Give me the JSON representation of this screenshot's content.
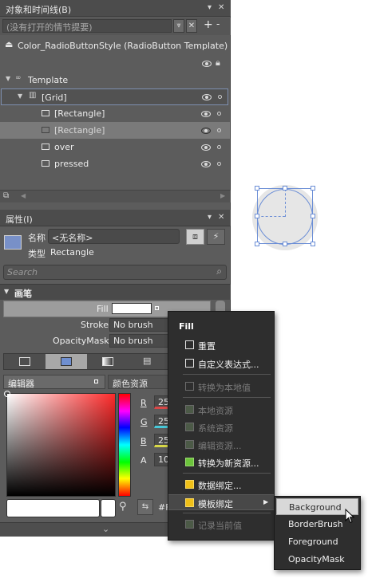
{
  "objects_panel": {
    "title": "对象和时间线(B)",
    "storyboard_placeholder": "(没有打开的情节提要)",
    "scope_title": "Color_RadioButtonStyle (RadioButton Template)",
    "tree": [
      {
        "label": "Template"
      },
      {
        "label": "[Grid]"
      },
      {
        "label": "[Rectangle]"
      },
      {
        "label": "[Rectangle]"
      },
      {
        "label": "over"
      },
      {
        "label": "pressed"
      }
    ]
  },
  "properties_panel": {
    "title": "属性(I)",
    "name_label": "名称",
    "name_value": "<无名称>",
    "type_label": "类型",
    "type_value": "Rectangle",
    "search_placeholder": "Search",
    "section_brush": "画笔",
    "fill_label": "Fill",
    "stroke_label": "Stroke",
    "stroke_value": "No brush",
    "opacitymask_label": "OpacityMask",
    "opacitymask_value": "No brush",
    "tab_editor": "编辑器",
    "tab_color_resources": "颜色资源",
    "channel_r": "R",
    "channel_g": "G",
    "channel_b": "B",
    "channel_a": "A",
    "value_r": "25",
    "value_g": "25",
    "value_b": "25",
    "value_a": "10",
    "hex_value": "#F"
  },
  "context_menu": {
    "header": "Fill",
    "items": [
      {
        "label": "重置",
        "enabled": true
      },
      {
        "label": "自定义表达式...",
        "enabled": true
      },
      {
        "label": "转换为本地值",
        "enabled": false
      },
      {
        "label": "本地资源",
        "enabled": false
      },
      {
        "label": "系统资源",
        "enabled": false
      },
      {
        "label": "编辑资源...",
        "enabled": false
      },
      {
        "label": "转换为新资源...",
        "enabled": true
      },
      {
        "label": "数据绑定...",
        "enabled": true
      },
      {
        "label": "模板绑定",
        "enabled": true
      },
      {
        "label": "记录当前值",
        "enabled": false
      }
    ]
  },
  "submenu": {
    "items": [
      "Background",
      "BorderBrush",
      "Foreground",
      "OpacityMask"
    ]
  },
  "colors": {
    "panel_bg": "#5c5c5c",
    "menu_bg": "#2e2e2e",
    "selection_accent": "#6b8ed6",
    "canvas_circle_fill": "#e6e6e6",
    "highlight_item": "#d8d8d8"
  }
}
